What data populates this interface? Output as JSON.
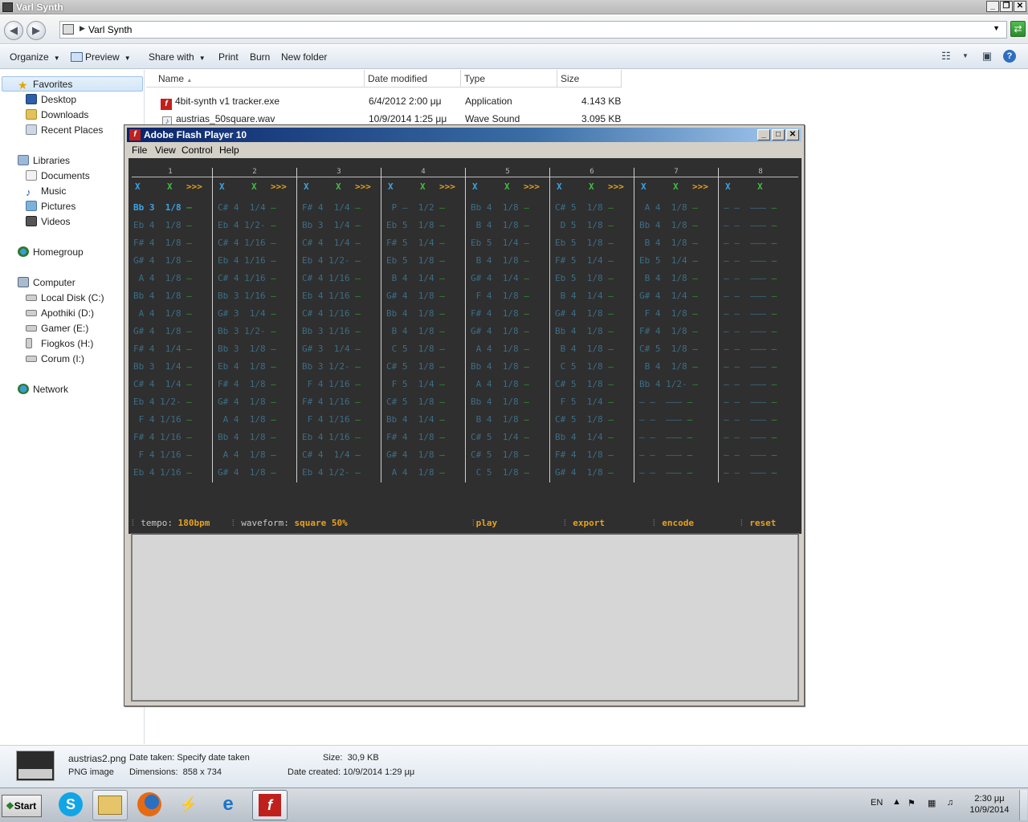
{
  "explorer": {
    "title": "Varl Synth",
    "address_path": "Varl Synth",
    "toolbar": {
      "organize": "Organize",
      "preview": "Preview",
      "share_with": "Share with",
      "print": "Print",
      "burn": "Burn",
      "new_folder": "New folder"
    },
    "nav": {
      "favorites": "Favorites",
      "desktop": "Desktop",
      "downloads": "Downloads",
      "recent_places": "Recent Places",
      "libraries": "Libraries",
      "documents": "Documents",
      "music": "Music",
      "pictures": "Pictures",
      "videos": "Videos",
      "homegroup": "Homegroup",
      "computer": "Computer",
      "drive_c": "Local Disk (C:)",
      "drive_d": "Apothiki (D:)",
      "drive_e": "Gamer (E:)",
      "drive_h": "Fiogkos (H:)",
      "drive_i": "Corum (I:)",
      "network": "Network"
    },
    "columns": {
      "name": "Name",
      "date_modified": "Date modified",
      "type": "Type",
      "size": "Size"
    },
    "files": [
      {
        "name": "4bit-synth v1 tracker.exe",
        "date": "6/4/2012 2:00 μμ",
        "type": "Application",
        "size": "4.143 KB"
      },
      {
        "name": "austrias_50square.wav",
        "date": "10/9/2014 1:25 μμ",
        "type": "Wave Sound",
        "size": "3.095 KB"
      }
    ],
    "details": {
      "filename": "austrias2.png",
      "filetype": "PNG image",
      "date_taken_label": "Date taken:",
      "date_taken_value": "Specify date taken",
      "dimensions_label": "Dimensions:",
      "dimensions_value": "858 x 734",
      "size_label": "Size:",
      "size_value": "30,9 KB",
      "date_created_label": "Date created:",
      "date_created_value": "10/9/2014 1:29 μμ"
    }
  },
  "taskbar": {
    "start": "Start",
    "lang": "EN",
    "time": "2:30 μμ",
    "date": "10/9/2014"
  },
  "flash": {
    "title": "Adobe Flash Player 10",
    "menu": {
      "file": "File",
      "view": "View",
      "control": "Control",
      "help": "Help"
    },
    "header_x": "X",
    "header_arrows": ">>>",
    "channels": [
      {
        "num": "1",
        "notes": [
          "Bb 3  1/8 —",
          "Eb 4  1/8 —",
          "F# 4  1/8 —",
          "G# 4  1/8 —",
          " A 4  1/8 —",
          "Bb 4  1/8 —",
          " A 4  1/8 —",
          "G# 4  1/8 —",
          "F# 4  1/4 —",
          "Bb 3  1/4 —",
          "C# 4  1/4 —",
          "Eb 4 1/2- —",
          " F 4 1/16 —",
          "F# 4 1/16 —",
          " F 4 1/16 —",
          "Eb 4 1/16 —"
        ]
      },
      {
        "num": "2",
        "notes": [
          "C# 4  1/4 —",
          "Eb 4 1/2- —",
          "C# 4 1/16 —",
          "Eb 4 1/16 —",
          "C# 4 1/16 —",
          "Bb 3 1/16 —",
          "G# 3  1/4 —",
          "Bb 3 1/2- —",
          "Bb 3  1/8 —",
          "Eb 4  1/8 —",
          "F# 4  1/8 —",
          "G# 4  1/8 —",
          " A 4  1/8 —",
          "Bb 4  1/8 —",
          " A 4  1/8 —",
          "G# 4  1/8 —"
        ]
      },
      {
        "num": "3",
        "notes": [
          "F# 4  1/4 —",
          "Bb 3  1/4 —",
          "C# 4  1/4 —",
          "Eb 4 1/2- —",
          "C# 4 1/16 —",
          "Eb 4 1/16 —",
          "C# 4 1/16 —",
          "Bb 3 1/16 —",
          "G# 3  1/4 —",
          "Bb 3 1/2- —",
          " F 4 1/16 —",
          "F# 4 1/16 —",
          " F 4 1/16 —",
          "Eb 4 1/16 —",
          "C# 4  1/4 —",
          "Eb 4 1/2- —"
        ]
      },
      {
        "num": "4",
        "notes": [
          " P —  1/2 —",
          "Eb 5  1/8 —",
          "F# 5  1/4 —",
          "Eb 5  1/8 —",
          " B 4  1/4 —",
          "G# 4  1/8 —",
          "Bb 4  1/8 —",
          " B 4  1/8 —",
          " C 5  1/8 —",
          "C# 5  1/8 —",
          " F 5  1/4 —",
          "C# 5  1/8 —",
          "Bb 4  1/4 —",
          "F# 4  1/8 —",
          "G# 4  1/8 —",
          " A 4  1/8 —"
        ]
      },
      {
        "num": "5",
        "notes": [
          "Bb 4  1/8 —",
          " B 4  1/8 —",
          "Eb 5  1/4 —",
          " B 4  1/8 —",
          "G# 4  1/4 —",
          " F 4  1/8 —",
          "F# 4  1/8 —",
          "G# 4  1/8 —",
          " A 4  1/8 —",
          "Bb 4  1/8 —",
          " A 4  1/8 —",
          "Bb 4  1/8 —",
          " B 4  1/8 —",
          "C# 5  1/4 —",
          "C# 5  1/8 —",
          " C 5  1/8 —"
        ]
      },
      {
        "num": "6",
        "notes": [
          "C# 5  1/8 —",
          " D 5  1/8 —",
          "Eb 5  1/8 —",
          "F# 5  1/4 —",
          "Eb 5  1/8 —",
          " B 4  1/4 —",
          "G# 4  1/8 —",
          "Bb 4  1/8 —",
          " B 4  1/8 —",
          " C 5  1/8 —",
          "C# 5  1/8 —",
          " F 5  1/4 —",
          "C# 5  1/8 —",
          "Bb 4  1/4 —",
          "F# 4  1/8 —",
          "G# 4  1/8 —"
        ]
      },
      {
        "num": "7",
        "notes": [
          " A 4  1/8 —",
          "Bb 4  1/8 —",
          " B 4  1/8 —",
          "Eb 5  1/4 —",
          " B 4  1/8 —",
          "G# 4  1/4 —",
          " F 4  1/8 —",
          "F# 4  1/8 —",
          "C# 5  1/8 —",
          " B 4  1/8 —",
          "Bb 4 1/2- —",
          "— —  ——— —",
          "— —  ——— —",
          "— —  ——— —",
          "— —  ——— —",
          "— —  ——— —"
        ]
      },
      {
        "num": "8",
        "notes": [
          "— —  ——— —",
          "— —  ——— —",
          "— —  ——— —",
          "— —  ——— —",
          "— —  ——— —",
          "— —  ——— —",
          "— —  ——— —",
          "— —  ——— —",
          "— —  ——— —",
          "— —  ——— —",
          "— —  ——— —",
          "— —  ——— —",
          "— —  ——— —",
          "— —  ——— —",
          "— —  ——— —",
          "— —  ——— —"
        ]
      }
    ],
    "controls": {
      "tempo_label": "tempo:",
      "tempo_value": "180bpm",
      "waveform_label": "waveform:",
      "waveform_value": "square 50%",
      "play": "play",
      "export": "export",
      "encode": "encode",
      "reset": "reset"
    },
    "colors": {
      "x_blue": "#3aa3e6",
      "x_green": "#3fbf3f",
      "arrows": "#e5a21d",
      "note": "#3b6e86",
      "dash": "#2c9a2c"
    }
  }
}
